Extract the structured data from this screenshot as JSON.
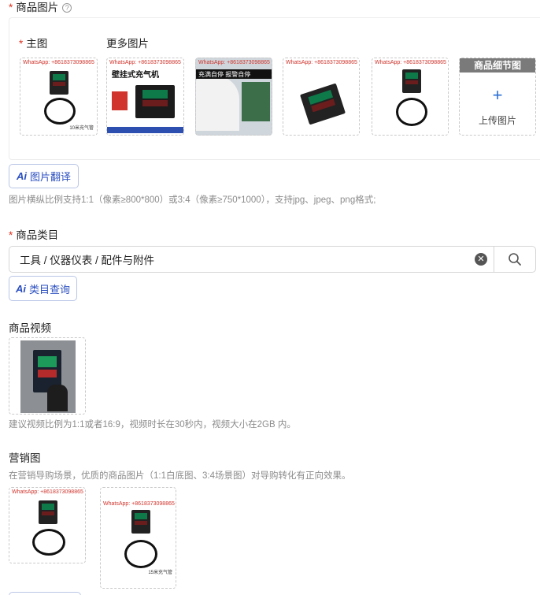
{
  "product_images": {
    "label": "商品图片",
    "main_label": "主图",
    "more_label": "更多图片",
    "watermark": "WhatsApp: +8618373098865",
    "upload_header": "商品细节图",
    "upload_label": "上传图片",
    "thumb2_title": "壁挂式充气机",
    "thumb3_caption": "充满自停 报警自停",
    "thumb1_caption": "10米充气管",
    "translate_button": "图片翻译",
    "hint": "图片横纵比例支持1:1（像素≥800*800）或3:4（像素≥750*1000），支持jpg、jpeg、png格式;"
  },
  "category": {
    "label": "商品类目",
    "value": "工具 / 仪器仪表 / 配件与附件",
    "query_button": "类目查询"
  },
  "video": {
    "label": "商品视频",
    "hint": "建议视频比例为1:1或者16:9，视频时长在30秒内，视频大小在2GB 内。"
  },
  "marketing": {
    "label": "营销图",
    "hint": "在营销导购场景，优质的商品图片（1:1白底图、3:4场景图）对导购转化有正向效果。",
    "watermark": "WhatsApp: +8618373098865",
    "thumb2_caption": "15米充气管"
  },
  "colors": {
    "required": "#e0301e",
    "accent": "#2b4fc0",
    "hint": "#8c8c8c"
  },
  "icons": {
    "help": "question-circle-icon",
    "clear": "close-circle-icon",
    "search": "search-icon",
    "ai": "ai-icon",
    "plus": "plus-icon"
  }
}
